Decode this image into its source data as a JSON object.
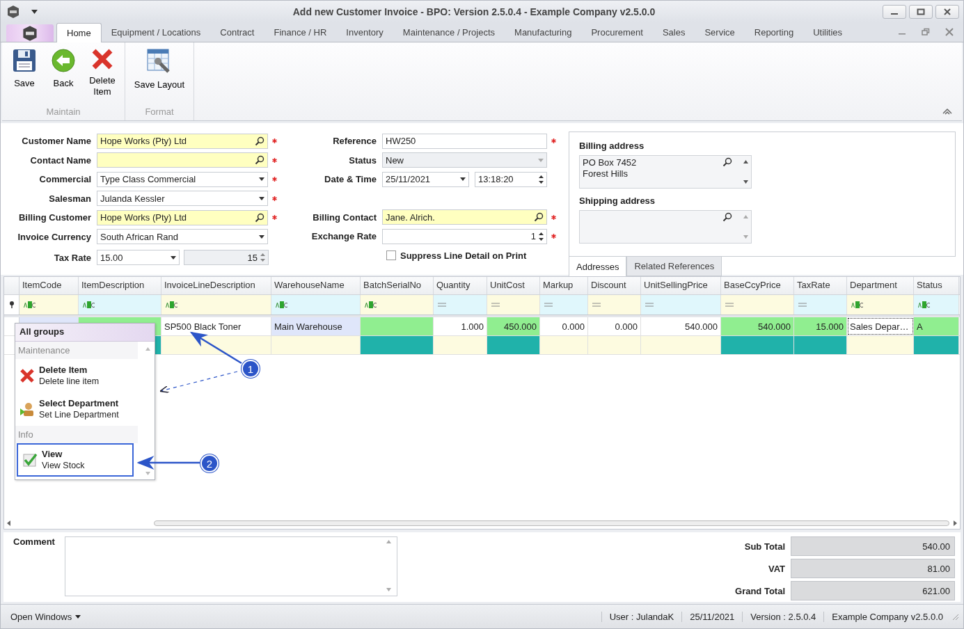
{
  "window": {
    "title": "Add new Customer Invoice - BPO: Version 2.5.0.4 - Example Company v2.5.0.0"
  },
  "ribbon_tabs": [
    {
      "label": "Home",
      "selected": true
    },
    {
      "label": "Equipment / Locations",
      "selected": false
    },
    {
      "label": "Contract",
      "selected": false
    },
    {
      "label": "Finance / HR",
      "selected": false
    },
    {
      "label": "Inventory",
      "selected": false
    },
    {
      "label": "Maintenance / Projects",
      "selected": false
    },
    {
      "label": "Manufacturing",
      "selected": false
    },
    {
      "label": "Procurement",
      "selected": false
    },
    {
      "label": "Sales",
      "selected": false
    },
    {
      "label": "Service",
      "selected": false
    },
    {
      "label": "Reporting",
      "selected": false
    },
    {
      "label": "Utilities",
      "selected": false
    }
  ],
  "ribbon_groups": [
    {
      "name": "Maintain",
      "buttons": [
        {
          "label": "Save",
          "kind": "save"
        },
        {
          "label": "Back",
          "kind": "back"
        },
        {
          "label": "Delete Item",
          "kind": "delete"
        }
      ]
    },
    {
      "name": "Format",
      "buttons": [
        {
          "label": "Save Layout",
          "kind": "layout"
        }
      ]
    }
  ],
  "form_left": [
    {
      "label": "Customer Name",
      "kind": "lookup",
      "value": "Hope Works (Pty) Ltd",
      "required": true
    },
    {
      "label": "Contact Name",
      "kind": "lookup",
      "required": true
    },
    {
      "label": "Commercial",
      "kind": "dropdown",
      "value": "Type Class Commercial",
      "required": true
    },
    {
      "label": "Salesman",
      "kind": "dropdown",
      "value": "Julanda Kessler",
      "required": true
    },
    {
      "label": "Billing Customer",
      "kind": "lookup",
      "value": "Hope Works (Pty) Ltd",
      "required": true
    },
    {
      "label": "Invoice Currency",
      "kind": "dropdown",
      "value": "South African Rand",
      "required": false
    },
    {
      "label": "Tax Rate",
      "kind": "dropdown-spin",
      "value": "15.00",
      "value2": "15",
      "required": false
    }
  ],
  "form_right": [
    {
      "label": "Reference",
      "kind": "text",
      "value": "HW250",
      "required": true
    },
    {
      "label": "Status",
      "kind": "disabled-dropdown",
      "value": "New",
      "required": false
    },
    {
      "label": "Date & Time",
      "kind": "date-time",
      "value": "25/11/2021",
      "value2": "13:18:20",
      "required": false
    },
    {
      "label": "Billing Contact",
      "kind": "lookup",
      "value": "Jane. Alrich.",
      "required": true
    },
    {
      "label": "Exchange Rate",
      "kind": "spin",
      "value": "1",
      "required": true
    }
  ],
  "suppress_line_detail": {
    "label": "Suppress Line Detail on Print",
    "checked": false
  },
  "addresses": {
    "billing_label": "Billing address",
    "billing_lines": [
      "PO Box 7452",
      "Forest Hills"
    ],
    "shipping_label": "Shipping address",
    "tabs": [
      {
        "label": "Addresses",
        "selected": true
      },
      {
        "label": "Related References",
        "selected": false
      }
    ]
  },
  "grid": {
    "columns": [
      {
        "name": "ItemCode",
        "kind": "text"
      },
      {
        "name": "ItemDescription",
        "kind": "text"
      },
      {
        "name": "InvoiceLineDescription",
        "kind": "text"
      },
      {
        "name": "WarehouseName",
        "kind": "text"
      },
      {
        "name": "BatchSerialNo",
        "kind": "text"
      },
      {
        "name": "Quantity",
        "kind": "number"
      },
      {
        "name": "UnitCost",
        "kind": "number"
      },
      {
        "name": "Markup",
        "kind": "number"
      },
      {
        "name": "Discount",
        "kind": "number"
      },
      {
        "name": "UnitSellingPrice",
        "kind": "number"
      },
      {
        "name": "BaseCcyPrice",
        "kind": "number"
      },
      {
        "name": "TaxRate",
        "kind": "number"
      },
      {
        "name": "Department",
        "kind": "text"
      },
      {
        "name": "Status",
        "kind": "text"
      }
    ],
    "rows": [
      {
        "cells": [
          {
            "kind": "lookup",
            "text": ""
          },
          {
            "kind": "computed",
            "text": ""
          },
          {
            "kind": "plain",
            "text": "SP500 Black Toner"
          },
          {
            "kind": "lookup",
            "text": "Main Warehouse"
          },
          {
            "kind": "computed",
            "text": ""
          },
          {
            "kind": "plain",
            "text": "1.000"
          },
          {
            "kind": "computed",
            "text": "450.000"
          },
          {
            "kind": "plain",
            "text": "0.000"
          },
          {
            "kind": "plain",
            "text": "0.000"
          },
          {
            "kind": "plain",
            "text": "540.000"
          },
          {
            "kind": "computed",
            "text": "540.000"
          },
          {
            "kind": "computed",
            "text": "15.000"
          },
          {
            "kind": "focused",
            "text": "Sales Depar…"
          },
          {
            "kind": "computed",
            "text": "A"
          }
        ]
      },
      {
        "cells": [
          {
            "kind": "new",
            "text": ""
          },
          {
            "kind": "locked",
            "text": ""
          },
          {
            "kind": "new",
            "text": ""
          },
          {
            "kind": "new",
            "text": ""
          },
          {
            "kind": "locked",
            "text": ""
          },
          {
            "kind": "new",
            "text": ""
          },
          {
            "kind": "locked",
            "text": ""
          },
          {
            "kind": "new",
            "text": ""
          },
          {
            "kind": "new",
            "text": ""
          },
          {
            "kind": "new",
            "text": ""
          },
          {
            "kind": "locked",
            "text": ""
          },
          {
            "kind": "locked",
            "text": ""
          },
          {
            "kind": "new",
            "text": ""
          },
          {
            "kind": "locked",
            "text": ""
          }
        ]
      }
    ]
  },
  "context_menu": {
    "title": "All groups",
    "groups": [
      {
        "name": "Maintenance",
        "items": [
          {
            "title": "Delete Item",
            "subtitle": "Delete line item",
            "kind": "delete",
            "selected": false
          },
          {
            "title": "Select Department",
            "subtitle": "Set Line Department",
            "kind": "person",
            "selected": false
          }
        ]
      },
      {
        "name": "Info",
        "items": [
          {
            "title": "View",
            "subtitle": "View Stock",
            "kind": "check",
            "selected": true
          }
        ]
      }
    ]
  },
  "callouts": [
    {
      "label": "1"
    },
    {
      "label": "2"
    }
  ],
  "comment": {
    "label": "Comment"
  },
  "totals": [
    {
      "label": "Sub Total",
      "value": "540.00"
    },
    {
      "label": "VAT",
      "value": "81.00"
    },
    {
      "label": "Grand Total",
      "value": "621.00"
    }
  ],
  "status_bar": {
    "menu": "Open Windows",
    "items": [
      "User : JulandaK",
      "25/11/2021",
      "Version : 2.5.0.4",
      "Example Company v2.5.0.0"
    ]
  }
}
